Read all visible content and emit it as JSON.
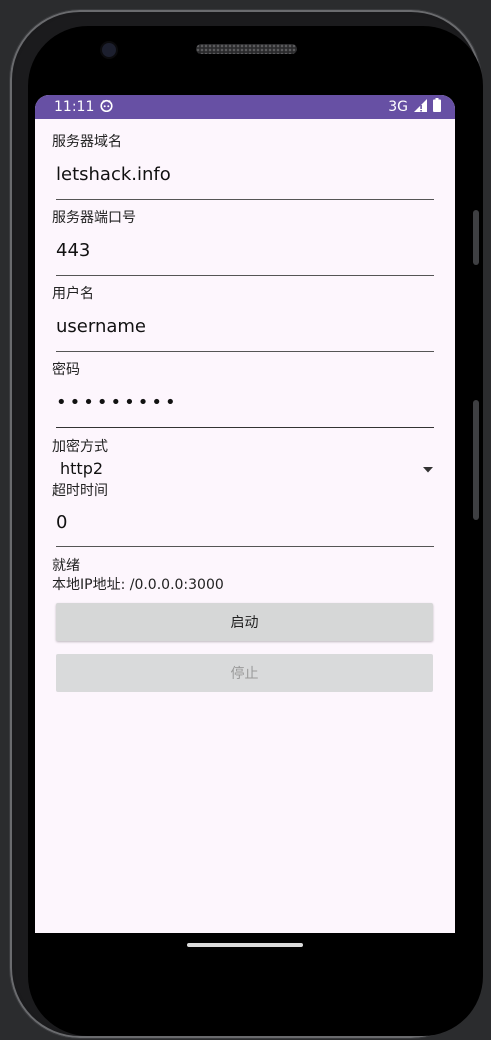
{
  "status_bar": {
    "time": "11:11",
    "network": "3G",
    "bar_color": "#6750a4"
  },
  "form": {
    "server_domain": {
      "label": "服务器域名",
      "value": "letshack.info"
    },
    "server_port": {
      "label": "服务器端口号",
      "value": "443"
    },
    "username": {
      "label": "用户名",
      "value": "username"
    },
    "password": {
      "label": "密码",
      "masked_value": "•••••••••"
    },
    "encryption": {
      "label": "加密方式",
      "selected": "http2"
    },
    "timeout": {
      "label": "超时时间",
      "value": "0"
    }
  },
  "status": {
    "state": "就绪",
    "local_ip": "本地IP地址: /0.0.0.0:3000"
  },
  "buttons": {
    "start": "启动",
    "stop": "停止"
  },
  "icons": {
    "status_app_icon": "android-face-icon",
    "signal": "signal-icon",
    "battery": "battery-icon",
    "dropdown": "dropdown-arrow-icon"
  }
}
